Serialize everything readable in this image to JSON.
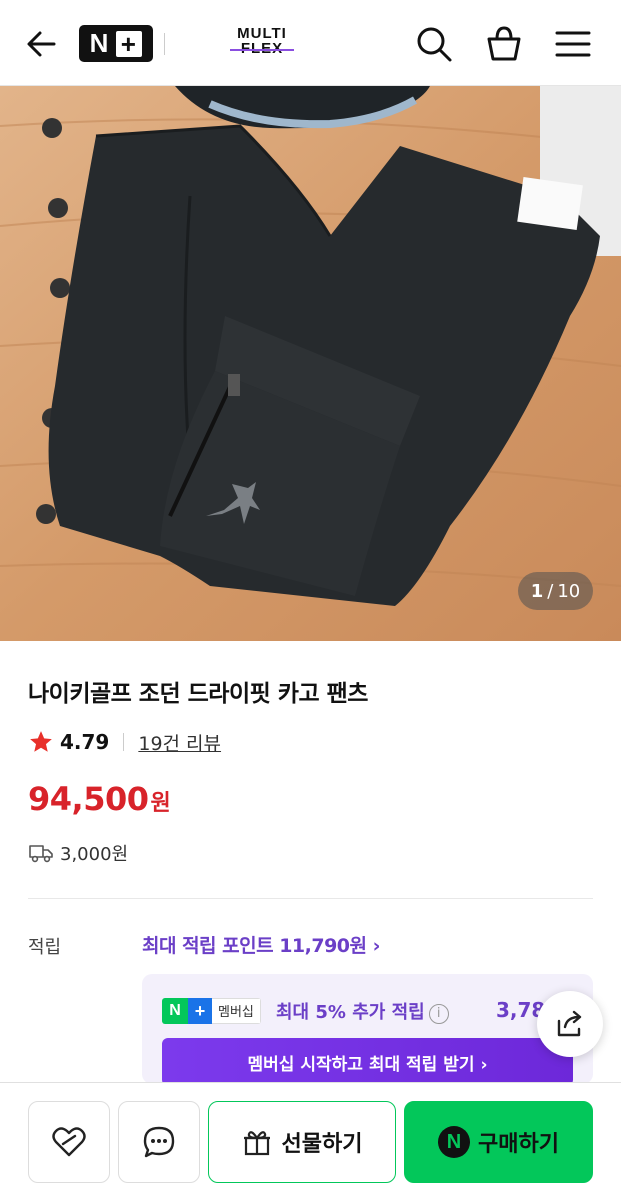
{
  "header": {
    "badge_n": "N",
    "badge_plus": "+",
    "brand_line1": "MULTI",
    "brand_line2": "FLEX"
  },
  "gallery": {
    "current": "1",
    "separator": "/",
    "total": "10"
  },
  "product": {
    "title": "나이키골프 조던 드라이핏 카고 팬츠",
    "rating": "4.79",
    "reviews": "19건 리뷰",
    "price": "94,500",
    "price_unit": "원",
    "shipping": "3,000원"
  },
  "points": {
    "label": "적립",
    "max_text": "최대 적립 포인트 11,790원",
    "chevron": "›",
    "membership_badge": "멤버십",
    "membership_text": "최대 5% 추가 적립",
    "info": "i",
    "membership_amount": "3,78",
    "cta": "멤버십 시작하고 최대 적립 받기 ›"
  },
  "bottom": {
    "gift": "선물하기",
    "buy": "구매하기",
    "buy_n": "N"
  },
  "colors": {
    "price": "#d8232a",
    "accent_purple": "#6b3fc7",
    "naver_green": "#03c75a"
  },
  "icons": [
    "back-arrow-icon",
    "search-icon",
    "cart-icon",
    "menu-icon",
    "star-icon",
    "truck-icon",
    "share-icon",
    "heart-icon",
    "chat-icon",
    "gift-icon"
  ]
}
